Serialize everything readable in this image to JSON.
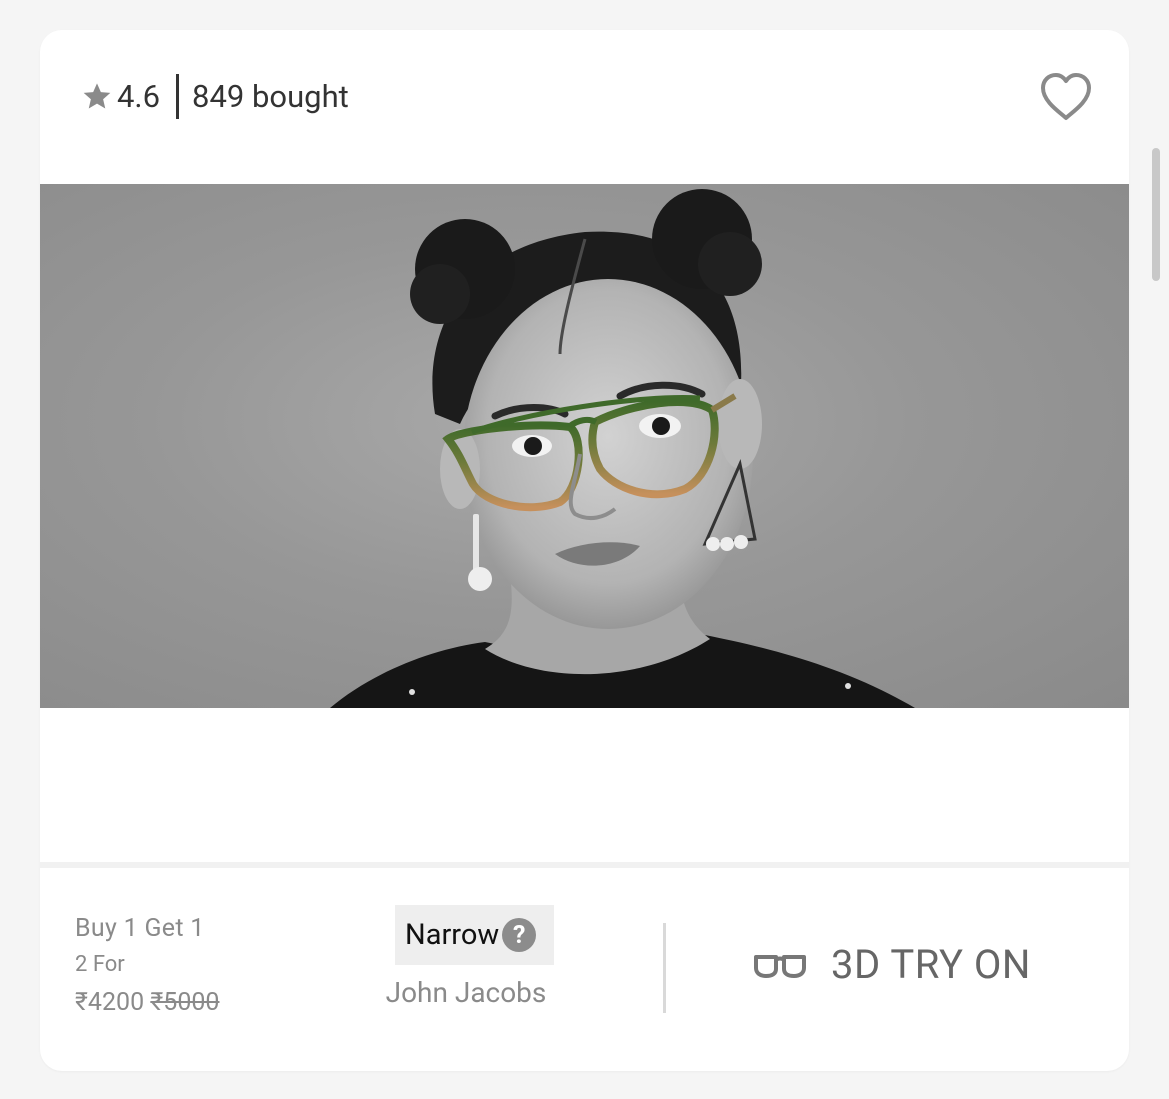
{
  "card": {
    "rating": "4.6",
    "bought": "849 bought",
    "icons": {
      "rating": "star-icon",
      "wishlist": "heart-icon",
      "tryon": "glasses-icon"
    },
    "offer": {
      "line1": "Buy 1 Get 1",
      "line2": "2 For",
      "price": "₹4200",
      "mrp": "₹5000"
    },
    "fit": {
      "label": "Narrow",
      "help": "?"
    },
    "brand": "John Jacobs",
    "tryon_label": "3D TRY ON"
  },
  "colors": {
    "background": "#f5f5f5",
    "card": "#ffffff",
    "frame_top": "#3f6a2a",
    "frame_bottom": "#c6905c"
  }
}
